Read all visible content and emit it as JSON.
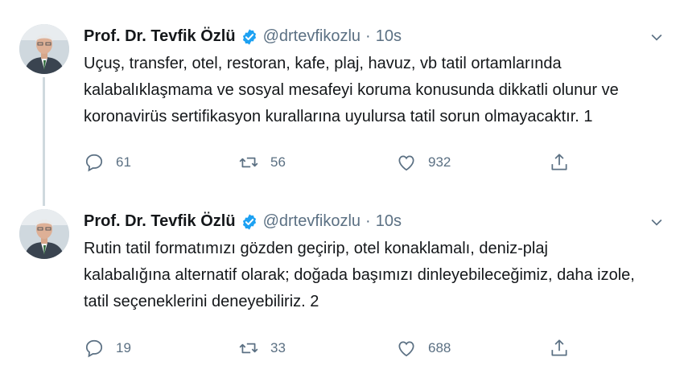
{
  "tweets": [
    {
      "author": "Prof. Dr. Tevfik Özlü",
      "handle": "@drtevfikozlu",
      "separator": "·",
      "time": "10s",
      "lines": [
        "Uçuş, transfer, otel, restoran, kafe, plaj, havuz, vb tatil ortamlarında",
        "kalabalıklaşmama ve sosyal mesafeyi koruma konusunda dikkatli olunur ve",
        "koronavirüs sertifikasyon kurallarına uyulursa tatil sorun olmayacaktır. 1"
      ],
      "replies": "61",
      "retweets": "56",
      "likes": "932"
    },
    {
      "author": "Prof. Dr. Tevfik Özlü",
      "handle": "@drtevfikozlu",
      "separator": "·",
      "time": "10s",
      "lines": [
        "Rutin tatil formatımızı gözden geçirip, otel konaklamalı, deniz-plaj",
        "kalabalığına alternatif olarak; doğada başımızı dinleyebileceğimiz, daha izole,",
        "tatil seçeneklerini deneyebiliriz. 2"
      ],
      "replies": "19",
      "retweets": "33",
      "likes": "688"
    }
  ],
  "colors": {
    "verified": "#1da1f2",
    "secondary_text": "#5b7083",
    "thread_line": "#cfd9de"
  },
  "icons": {
    "reply": "speech-bubble-icon",
    "retweet": "retweet-arrows-icon",
    "like": "heart-outline-icon",
    "share": "share-upload-icon",
    "menu": "chevron-down-icon",
    "verified": "verified-badge-icon"
  }
}
